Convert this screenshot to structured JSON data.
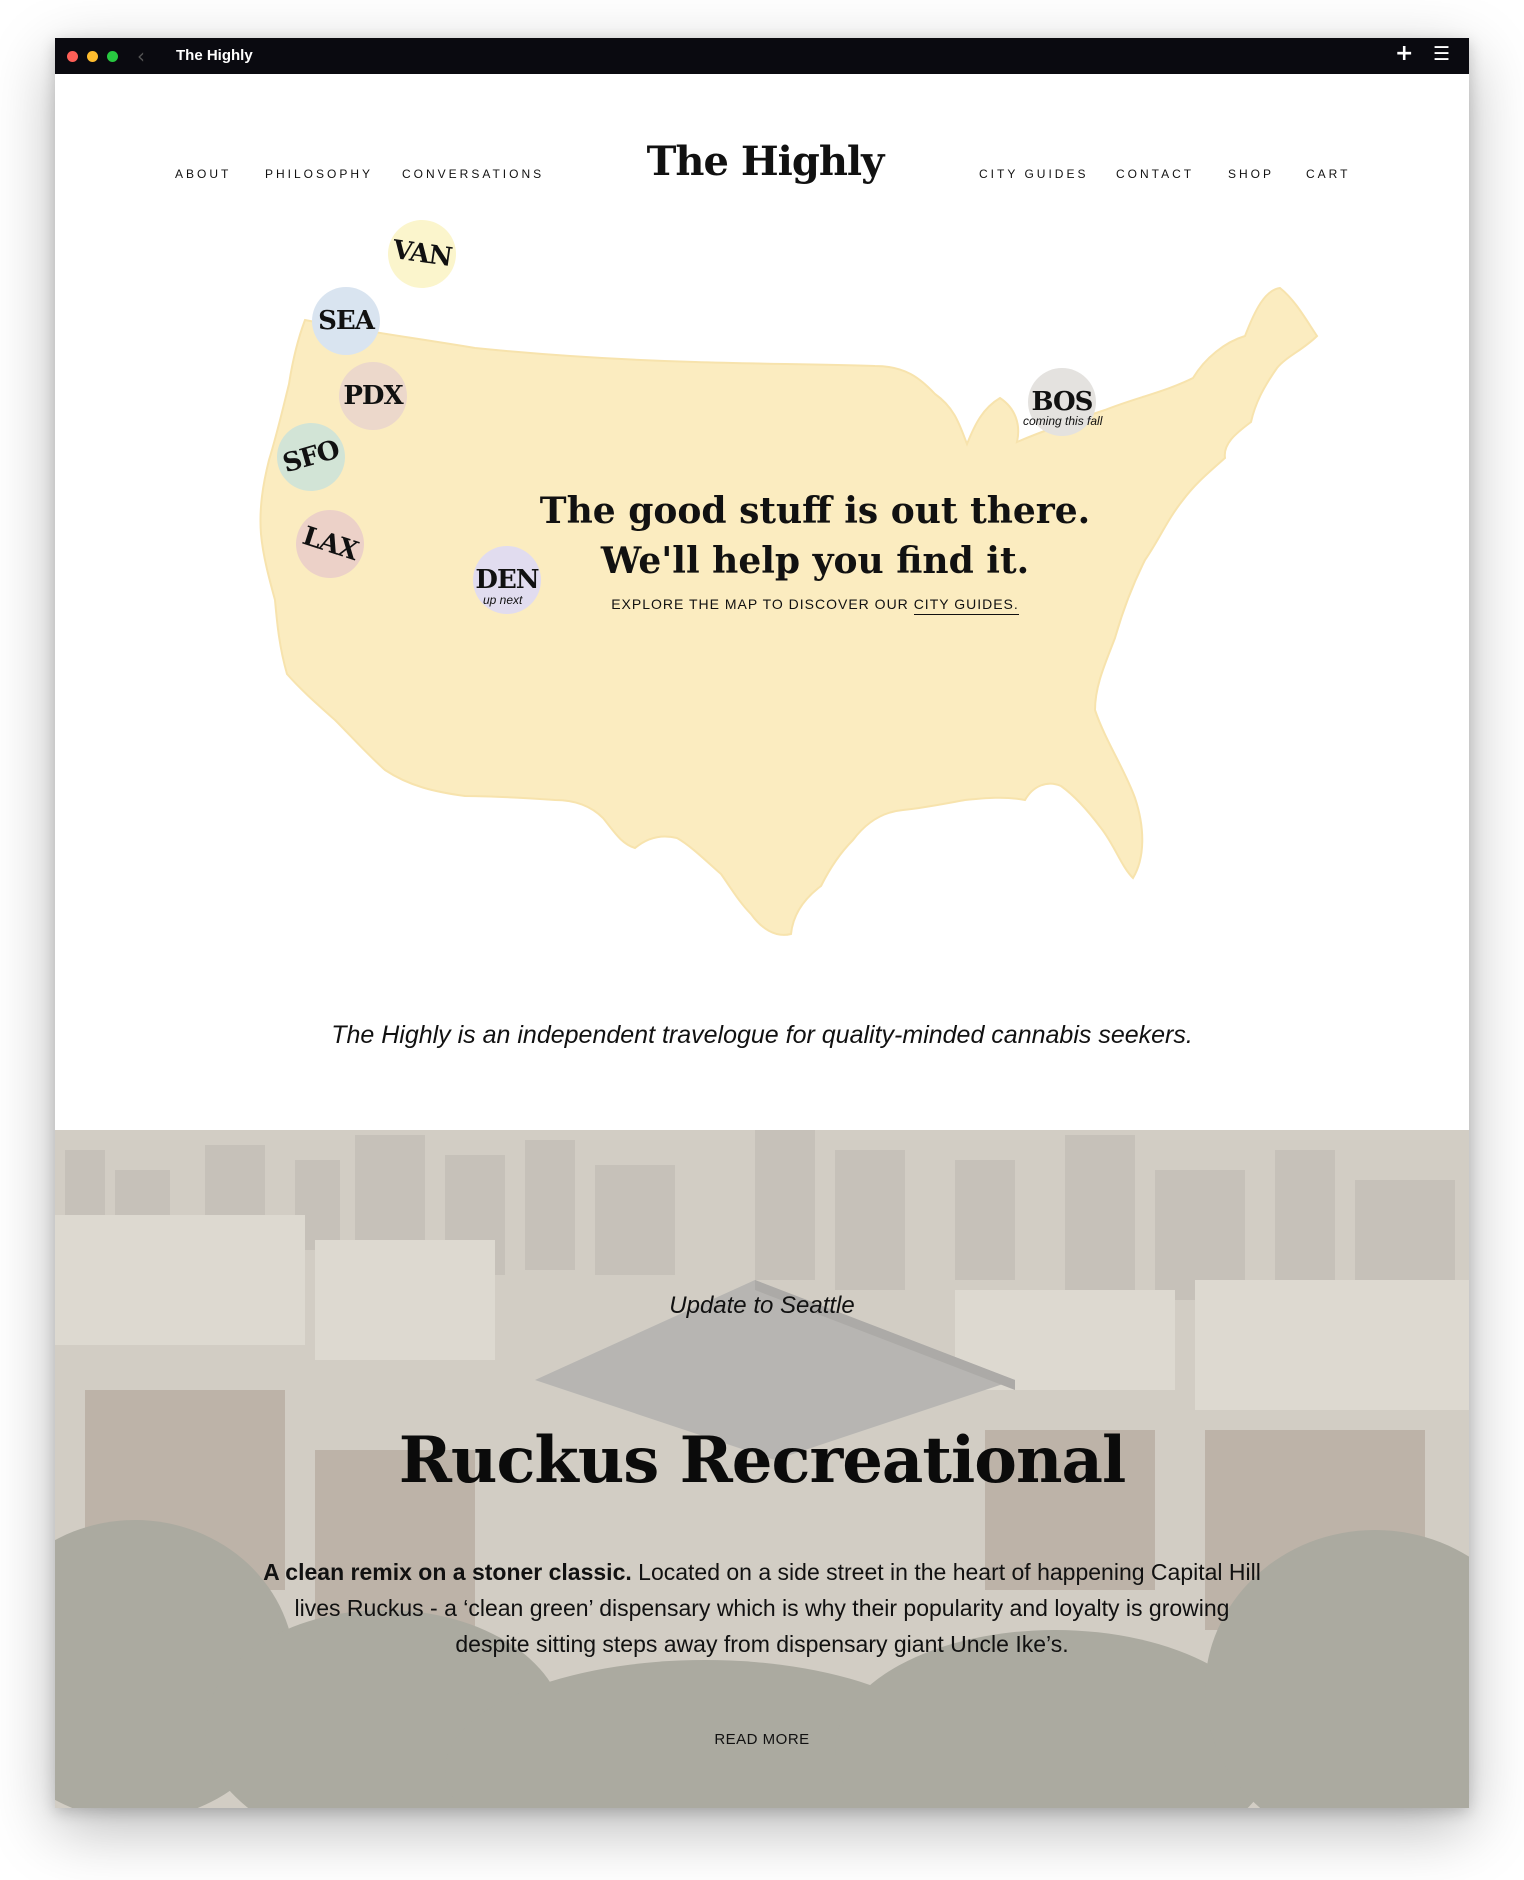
{
  "window": {
    "title": "The Highly"
  },
  "nav": {
    "left": [
      "ABOUT",
      "PHILOSOPHY",
      "CONVERSATIONS"
    ],
    "right": [
      "CITY GUIDES",
      "CONTACT",
      "SHOP",
      "CART"
    ],
    "logo": "The Highly"
  },
  "map": {
    "pins": [
      {
        "label": "VAN",
        "color": "#fbf5cc"
      },
      {
        "label": "SEA",
        "color": "#d9e4f0"
      },
      {
        "label": "PDX",
        "color": "#ecd8cb"
      },
      {
        "label": "SFO",
        "color": "#d2e4d6"
      },
      {
        "label": "LAX",
        "color": "#ecd1c8"
      },
      {
        "label": "DEN",
        "color": "#e1dcef",
        "note": "up next"
      },
      {
        "label": "BOS",
        "color": "#e4e2df",
        "note": "coming this fall"
      }
    ],
    "land_color": "#fbecc0"
  },
  "hero": {
    "line1": "The good stuff is out there.",
    "line2": "We'll help you find it.",
    "explore_prefix": "EXPLORE THE MAP TO DISCOVER OUR ",
    "explore_link": "CITY GUIDES."
  },
  "tagline": "The Highly is an independent travelogue for quality-minded cannabis seekers.",
  "feature": {
    "kicker": "Update to Seattle",
    "title": "Ruckus Recreational",
    "lead": "A clean remix on a stoner classic.",
    "body": " Located on a side street in the heart of happening Capital Hill lives Ruckus - a ‘clean green’ dispensary which is why their popularity and loyalty is growing despite sitting steps away from dispensary giant Uncle Ike’s.",
    "read_more": "READ MORE"
  }
}
